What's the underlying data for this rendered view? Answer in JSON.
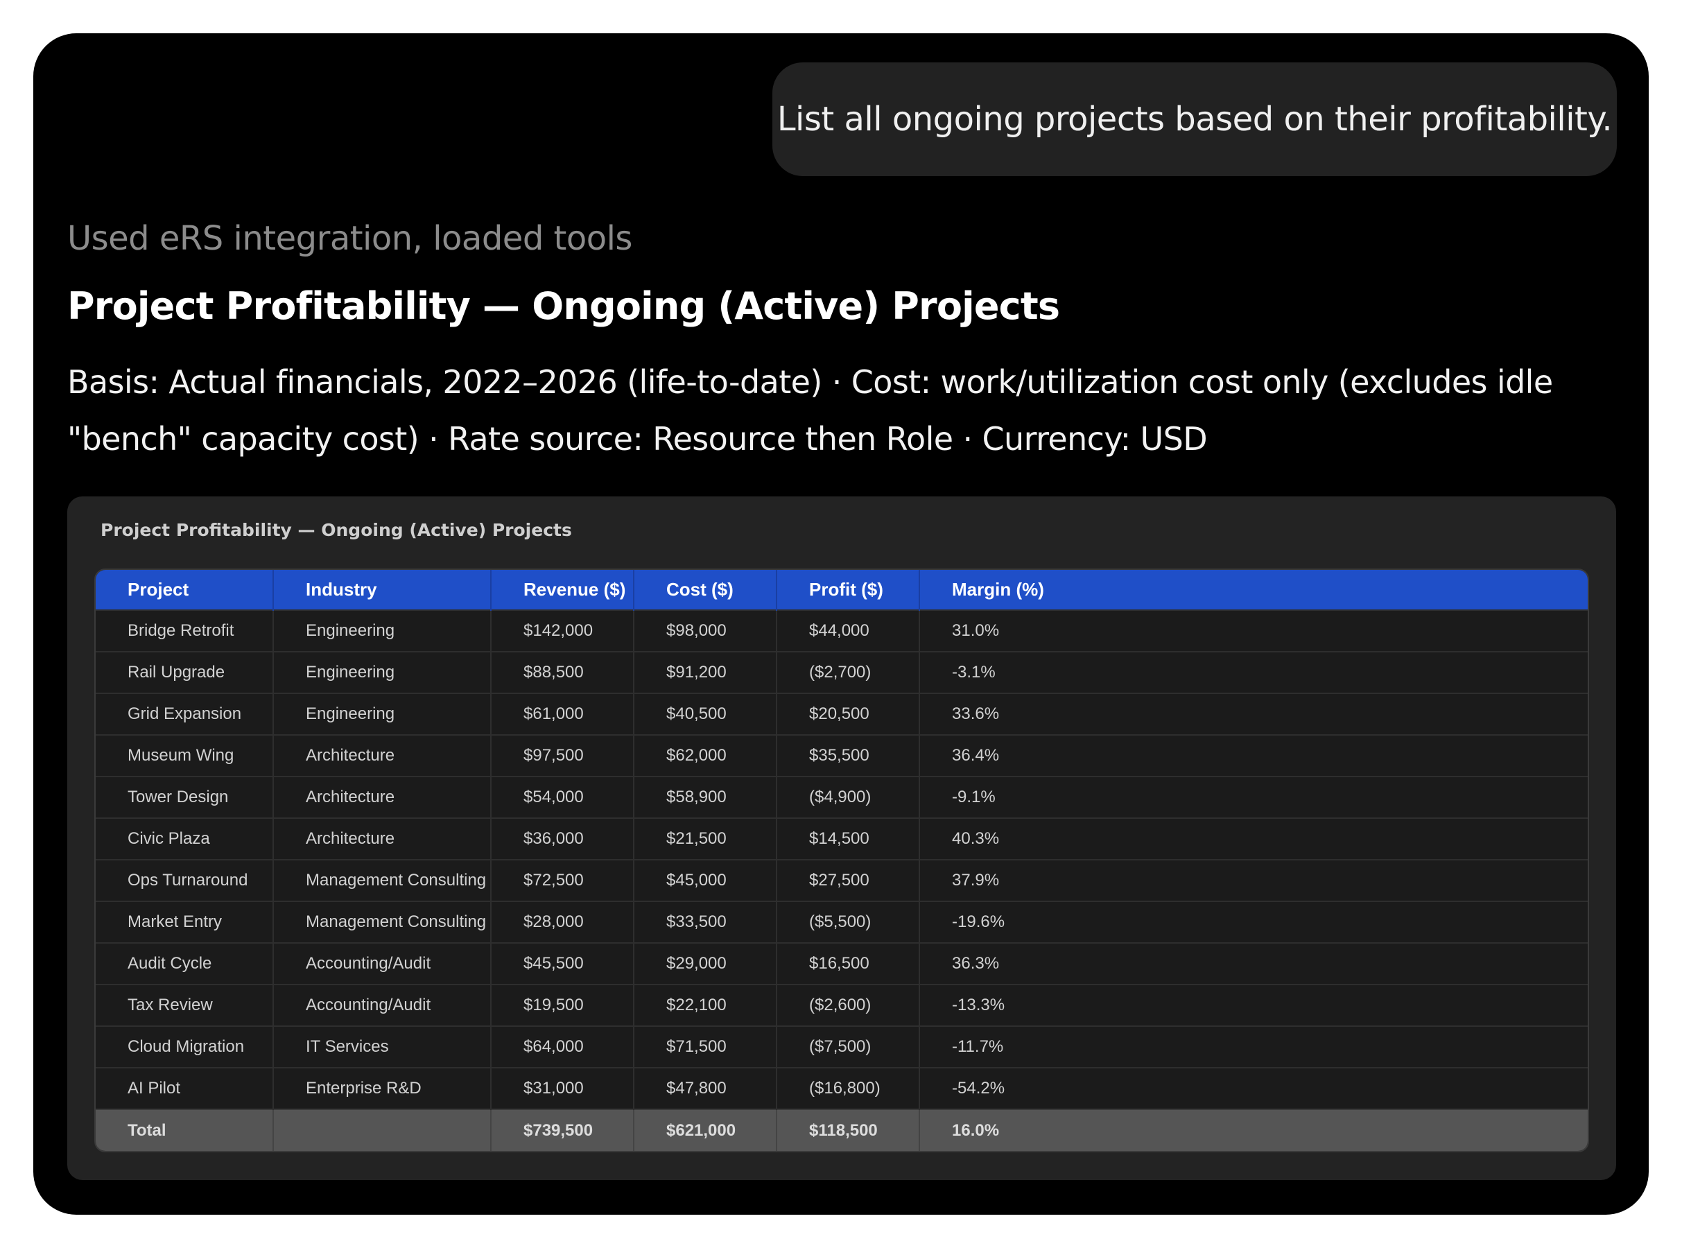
{
  "chat": {
    "user_message": "List all ongoing projects based on their profitability."
  },
  "response": {
    "tools_status": "Used eRS integration, loaded tools",
    "heading": "Project Profitability — Ongoing (Active) Projects",
    "basis_line1": "Basis: Actual financials, 2022–2026 (life-to-date) · Cost: work/utilization cost only (excludes idle",
    "basis_line2": "\"bench\" capacity cost) · Rate source: Resource then Role · Currency: USD"
  },
  "table_card": {
    "title": "Project Profitability — Ongoing (Active) Projects",
    "columns": [
      "Project",
      "Industry",
      "Revenue ($)",
      "Cost ($)",
      "Profit ($)",
      "Margin (%)"
    ],
    "rows": [
      [
        "Bridge Retrofit",
        "Engineering",
        "$142,000",
        "$98,000",
        "$44,000",
        "31.0%"
      ],
      [
        "Rail Upgrade",
        "Engineering",
        "$88,500",
        "$91,200",
        "($2,700)",
        "-3.1%"
      ],
      [
        "Grid Expansion",
        "Engineering",
        "$61,000",
        "$40,500",
        "$20,500",
        "33.6%"
      ],
      [
        "Museum Wing",
        "Architecture",
        "$97,500",
        "$62,000",
        "$35,500",
        "36.4%"
      ],
      [
        "Tower Design",
        "Architecture",
        "$54,000",
        "$58,900",
        "($4,900)",
        "-9.1%"
      ],
      [
        "Civic Plaza",
        "Architecture",
        "$36,000",
        "$21,500",
        "$14,500",
        "40.3%"
      ],
      [
        "Ops Turnaround",
        "Management Consulting",
        "$72,500",
        "$45,000",
        "$27,500",
        "37.9%"
      ],
      [
        "Market Entry",
        "Management Consulting",
        "$28,000",
        "$33,500",
        "($5,500)",
        "-19.6%"
      ],
      [
        "Audit Cycle",
        "Accounting/Audit",
        "$45,500",
        "$29,000",
        "$16,500",
        "36.3%"
      ],
      [
        "Tax Review",
        "Accounting/Audit",
        "$19,500",
        "$22,100",
        "($2,600)",
        "-13.3%"
      ],
      [
        "Cloud Migration",
        "IT Services",
        "$64,000",
        "$71,500",
        "($7,500)",
        "-11.7%"
      ],
      [
        "AI Pilot",
        "Enterprise R&D",
        "$31,000",
        "$47,800",
        "($16,800)",
        "-54.2%"
      ]
    ],
    "total": [
      "Total",
      "",
      "$739,500",
      "$621,000",
      "$118,500",
      "16.0%"
    ]
  },
  "colors": {
    "background": "#000000",
    "bubble": "#222222",
    "card": "#232323",
    "header_accent": "#1f4fc8",
    "total_row": "#555555"
  }
}
